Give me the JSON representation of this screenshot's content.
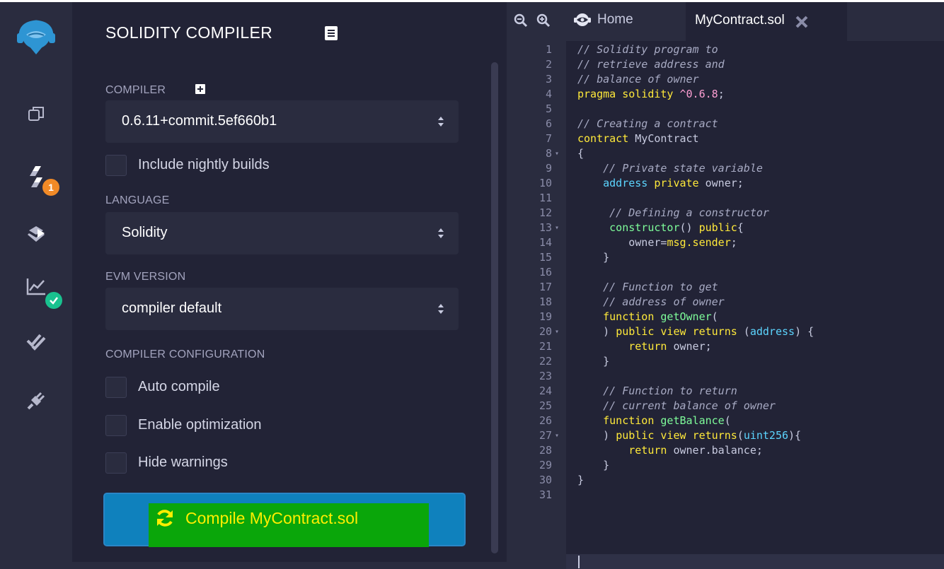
{
  "rail": {
    "compiler_badge": "1"
  },
  "panel": {
    "title": "SOLIDITY COMPILER",
    "compiler_label": "COMPILER",
    "compiler_value": "0.6.11+commit.5ef660b1",
    "nightly_label": "Include nightly builds",
    "language_label": "LANGUAGE",
    "language_value": "Solidity",
    "evm_label": "EVM VERSION",
    "evm_value": "compiler default",
    "config_label": "COMPILER CONFIGURATION",
    "auto_compile_label": "Auto compile",
    "optimization_label": "Enable optimization",
    "hide_warnings_label": "Hide warnings",
    "compile_button_label": "Compile MyContract.sol"
  },
  "editor": {
    "home_tab_label": "Home",
    "active_tab_label": "MyContract.sol",
    "lines": [
      {
        "n": "1",
        "fold": false,
        "html": "<span class=\"c\">// Solidity program to</span>"
      },
      {
        "n": "2",
        "fold": false,
        "html": "<span class=\"c\">// retrieve address and</span>"
      },
      {
        "n": "3",
        "fold": false,
        "html": "<span class=\"c\">// balance of owner</span>"
      },
      {
        "n": "4",
        "fold": false,
        "html": "<span class=\"k\">pragma solidity</span> <span class=\"n\">^0.6.8</span>;"
      },
      {
        "n": "5",
        "fold": false,
        "html": ""
      },
      {
        "n": "6",
        "fold": false,
        "html": "<span class=\"c\">// Creating a contract</span>"
      },
      {
        "n": "7",
        "fold": false,
        "html": "<span class=\"k\">contract</span> MyContract"
      },
      {
        "n": "8",
        "fold": true,
        "html": "{"
      },
      {
        "n": "9",
        "fold": false,
        "html": "    <span class=\"c\">// Private state variable</span>"
      },
      {
        "n": "10",
        "fold": false,
        "html": "    <span class=\"t\">address</span> <span class=\"k\">private</span> owner;"
      },
      {
        "n": "11",
        "fold": false,
        "html": ""
      },
      {
        "n": "12",
        "fold": false,
        "html": "     <span class=\"c\">// Defining a constructor</span>"
      },
      {
        "n": "13",
        "fold": true,
        "html": "     <span class=\"f\">constructor</span>() <span class=\"k\">public</span>{"
      },
      {
        "n": "14",
        "fold": false,
        "html": "        owner=<span class=\"k\">msg.sender</span>;"
      },
      {
        "n": "15",
        "fold": false,
        "html": "    }"
      },
      {
        "n": "16",
        "fold": false,
        "html": ""
      },
      {
        "n": "17",
        "fold": false,
        "html": "    <span class=\"c\">// Function to get</span>"
      },
      {
        "n": "18",
        "fold": false,
        "html": "    <span class=\"c\">// address of owner</span>"
      },
      {
        "n": "19",
        "fold": false,
        "html": "    <span class=\"k\">function</span> <span class=\"f\">getOwner</span>("
      },
      {
        "n": "20",
        "fold": true,
        "html": "    ) <span class=\"k\">public</span> <span class=\"k\">view</span> <span class=\"k\">returns</span> (<span class=\"t\">address</span>) {"
      },
      {
        "n": "21",
        "fold": false,
        "html": "        <span class=\"k\">return</span> owner;"
      },
      {
        "n": "22",
        "fold": false,
        "html": "    }"
      },
      {
        "n": "23",
        "fold": false,
        "html": ""
      },
      {
        "n": "24",
        "fold": false,
        "html": "    <span class=\"c\">// Function to return</span>"
      },
      {
        "n": "25",
        "fold": false,
        "html": "    <span class=\"c\">// current balance of owner</span>"
      },
      {
        "n": "26",
        "fold": false,
        "html": "    <span class=\"k\">function</span> <span class=\"f\">getBalance</span>("
      },
      {
        "n": "27",
        "fold": true,
        "html": "    ) <span class=\"k\">public</span> <span class=\"k\">view</span> <span class=\"k\">returns</span>(<span class=\"t\">uint256</span>){"
      },
      {
        "n": "28",
        "fold": false,
        "html": "        <span class=\"k\">return</span> owner.balance;"
      },
      {
        "n": "29",
        "fold": false,
        "html": "    }"
      },
      {
        "n": "30",
        "fold": false,
        "html": "}"
      },
      {
        "n": "31",
        "fold": false,
        "html": ""
      }
    ]
  },
  "colors": {
    "panel_bg": "#222336",
    "rail_bg": "#2a2c3f",
    "compile_button": "#0f81bd",
    "compile_highlight": "#0aa60a",
    "compile_text": "#ffee00",
    "badge_orange": "#f18a27",
    "badge_green": "#19c28f"
  },
  "icons": {
    "rail": [
      "remix-logo-icon",
      "file-explorer-icon",
      "solidity-compiler-icon",
      "deploy-run-icon",
      "analysis-icon",
      "testing-icon",
      "plugin-manager-icon"
    ],
    "editor": [
      "zoom-out-icon",
      "zoom-in-icon",
      "home-eye-icon",
      "close-tab-icon"
    ]
  }
}
